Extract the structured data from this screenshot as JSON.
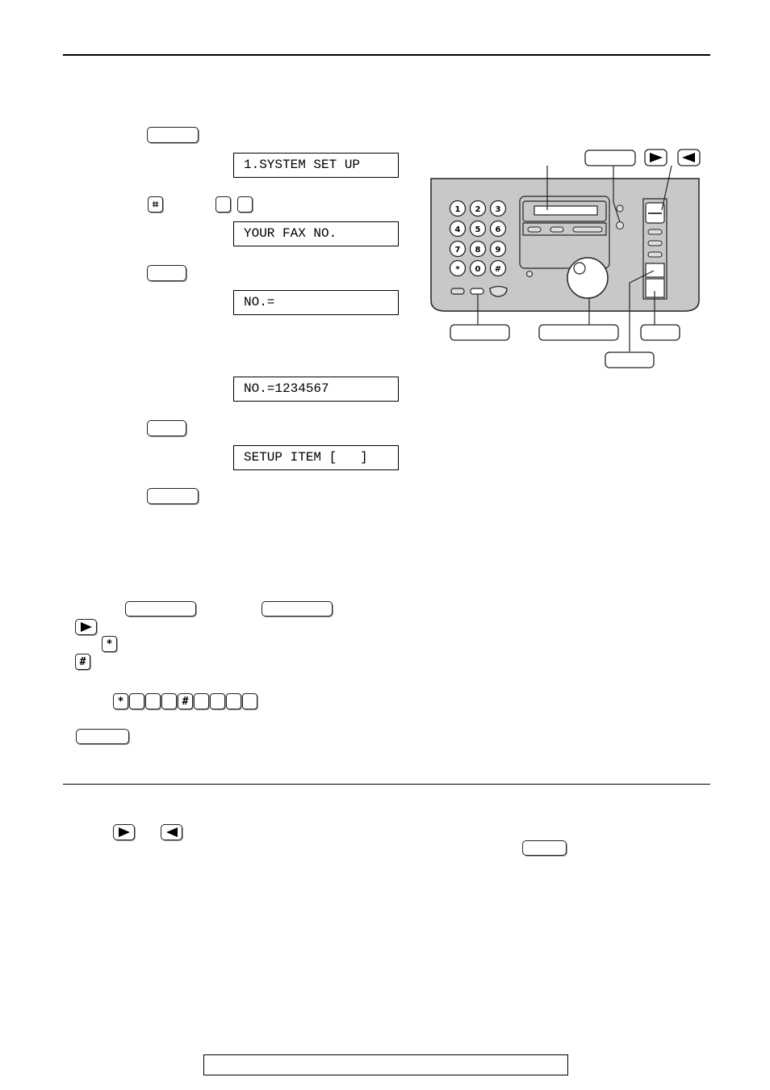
{
  "page": {
    "type": "fax-machine-manual-page",
    "footer_text": ""
  },
  "procedure": {
    "steps": [
      {
        "key": "menu-key",
        "label": ""
      },
      {
        "display": "1.SYSTEM SET UP"
      },
      {
        "key": "hash-key",
        "glyph": "#",
        "extra_keys": [
          "",
          ""
        ]
      },
      {
        "display": "YOUR FAX NO."
      },
      {
        "key": "set-key",
        "label": ""
      },
      {
        "display": "NO.="
      },
      {
        "display": "NO.=1234567"
      },
      {
        "key": "set-key",
        "label": ""
      },
      {
        "display": "SETUP ITEM [   ]"
      },
      {
        "key": "menu-key",
        "label": ""
      }
    ]
  },
  "lcd_displays": [
    "1.SYSTEM SET UP",
    "YOUR FAX NO.",
    "NO.=",
    "NO.=1234567",
    "SETUP ITEM [   ]"
  ],
  "notes": {
    "key_glyphs": {
      "forward_arrow": "▶",
      "back_arrow": "◀",
      "star": "∗",
      "hash": "⌗"
    },
    "example_sequence": [
      "*",
      "",
      "",
      "",
      "#",
      "",
      "",
      "",
      ""
    ]
  },
  "device": {
    "keypad": [
      "1",
      "2",
      "3",
      "4",
      "5",
      "6",
      "7",
      "8",
      "9",
      "*",
      "0",
      "#"
    ],
    "colors": {
      "body": "#c8c8c8",
      "outline": "#222222"
    }
  }
}
